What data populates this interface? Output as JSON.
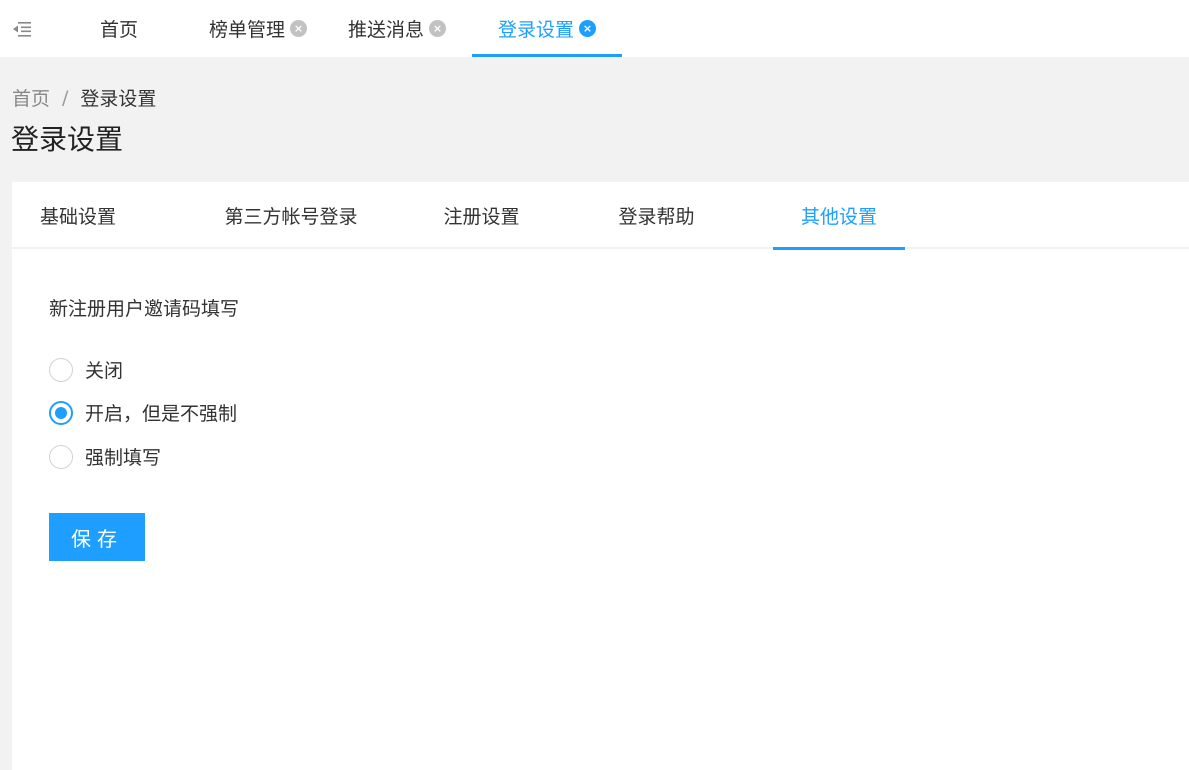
{
  "top_tabs": [
    {
      "label": "首页",
      "closable": false,
      "active": false
    },
    {
      "label": "榜单管理",
      "closable": true,
      "active": false
    },
    {
      "label": "推送消息",
      "closable": true,
      "active": false
    },
    {
      "label": "登录设置",
      "closable": true,
      "active": true
    }
  ],
  "close_glyph": "×",
  "breadcrumb": {
    "home": "首页",
    "separator": "/",
    "current": "登录设置"
  },
  "page_title": "登录设置",
  "sub_tabs": [
    {
      "label": "基础设置",
      "active": false
    },
    {
      "label": "第三方帐号登录",
      "active": false
    },
    {
      "label": "注册设置",
      "active": false
    },
    {
      "label": "登录帮助",
      "active": false
    },
    {
      "label": "其他设置",
      "active": true
    }
  ],
  "invite_setting": {
    "label": "新注册用户邀请码填写",
    "options": [
      {
        "label": "关闭",
        "checked": false
      },
      {
        "label": "开启，但是不强制",
        "checked": true
      },
      {
        "label": "强制填写",
        "checked": false
      }
    ]
  },
  "save_label": "保存",
  "colors": {
    "accent": "#1e9fff",
    "page_bg": "#f2f2f2"
  },
  "icons": {
    "menu_toggle": "menu-fold-icon",
    "tab_close": "close-circle-icon"
  }
}
